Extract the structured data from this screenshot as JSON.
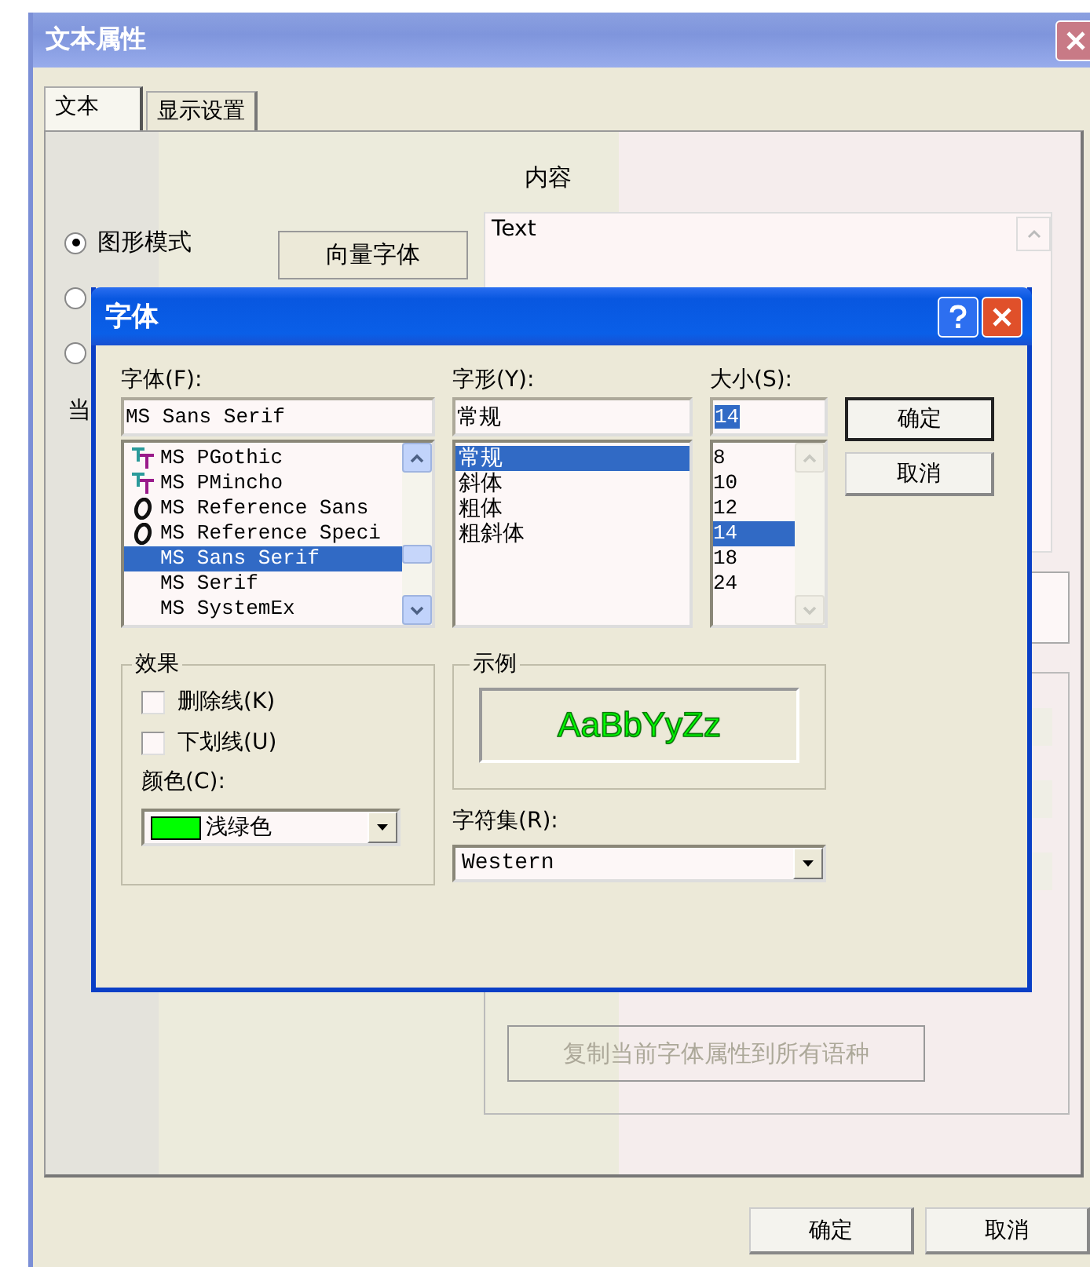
{
  "window": {
    "title": "文本属性"
  },
  "tabs": [
    {
      "label": "文本",
      "selected": true
    },
    {
      "label": "显示设置",
      "selected": false
    }
  ],
  "content_label": "内容",
  "mode_options": [
    {
      "label": "图形模式",
      "selected": true
    },
    {
      "selected": false
    },
    {
      "selected": false
    }
  ],
  "vector_font_button": "向量字体",
  "content_text": "Text",
  "partial_label": "当",
  "copy_button": {
    "label": "复制当前字体属性到所有语种",
    "disabled": true
  },
  "buttons": [
    "确定",
    "取消"
  ],
  "font_dialog": {
    "title": "字体",
    "font": {
      "label": "字体(F):",
      "value": "MS Sans Serif",
      "items": [
        {
          "name": "MS PGothic",
          "kind": "truetype",
          "selected": false
        },
        {
          "name": "MS PMincho",
          "kind": "truetype",
          "selected": false
        },
        {
          "name": "MS Reference Sans",
          "kind": "opentype",
          "selected": false
        },
        {
          "name": "MS Reference Speci",
          "kind": "opentype",
          "selected": false
        },
        {
          "name": "MS Sans Serif",
          "kind": "raster",
          "selected": true
        },
        {
          "name": "MS Serif",
          "kind": "raster",
          "selected": false
        },
        {
          "name": "MS SystemEx",
          "kind": "raster",
          "selected": false
        }
      ]
    },
    "style": {
      "label": "字形(Y):",
      "value": "常规",
      "items": [
        {
          "name": "常规",
          "selected": true
        },
        {
          "name": "斜体",
          "selected": false
        },
        {
          "name": "粗体",
          "selected": false
        },
        {
          "name": "粗斜体",
          "selected": false
        }
      ]
    },
    "size": {
      "label": "大小(S):",
      "value": "14",
      "items": [
        {
          "name": "8",
          "selected": false
        },
        {
          "name": "10",
          "selected": false
        },
        {
          "name": "12",
          "selected": false
        },
        {
          "name": "14",
          "selected": true
        },
        {
          "name": "18",
          "selected": false
        },
        {
          "name": "24",
          "selected": false
        }
      ]
    },
    "ok": "确定",
    "cancel": "取消",
    "effects": {
      "title": "效果",
      "options": [
        {
          "label": "删除线(K)",
          "checked": false
        },
        {
          "label": "下划线(U)",
          "checked": false
        }
      ]
    },
    "color": {
      "label": "颜色(C):",
      "value": "浅绿色",
      "color": "#00ff00"
    },
    "sample": {
      "title": "示例",
      "text": "AaBbYyZz"
    },
    "charset": {
      "label": "字符集(R):",
      "value": "Western"
    }
  }
}
